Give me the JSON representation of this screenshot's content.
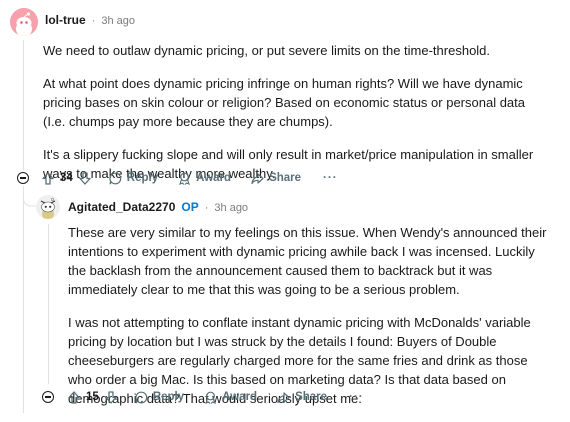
{
  "comments": [
    {
      "username": "lol-true",
      "separator": "·",
      "time": "3h ago",
      "paragraphs": [
        "We need to outlaw dynamic pricing, or put severe limits on the time-threshold.",
        "At what point does dynamic pricing infringe on human rights? Will we have dynamic pricing bases on skin colour or religion? Based on economic status or personal data (I.e. chumps pay more because they are chumps).",
        "It's a slippery fucking slope and will only result in market/price manipulation in smaller ways to make the wealthy more wealthy."
      ],
      "votes": "34",
      "reply_label": "Reply",
      "award_label": "Award",
      "share_label": "Share",
      "more_label": "···"
    },
    {
      "username": "Agitated_Data2270",
      "op_badge": "OP",
      "separator": "·",
      "time": "3h ago",
      "paragraphs": [
        "These are very similar to my feelings on this issue. When Wendy's announced their intentions to experiment with dynamic pricing awhile back I was incensed. Luckily the backlash from the announcement caused them to backtrack but it was immediately clear to me that this was going to be a serious problem.",
        "I was not attempting to conflate instant dynamic pricing with McDonalds' variable pricing by location but I was struck by the details I found: Buyers of Double cheeseburgers are regularly charged more for the same fries and drink as those who order a big Mac. Is this based on marketing data? Is that data based on demographic data? That would seriously upset me."
      ],
      "votes": "15",
      "reply_label": "Reply",
      "award_label": "Award",
      "share_label": "Share",
      "more_label": "···"
    }
  ],
  "colors": {
    "op": "#0079d3",
    "meta": "#7c7c7c",
    "action": "#576f76",
    "avatar1": "#e85d75"
  },
  "icons": [
    "avatar-snoo",
    "collapse-icon",
    "upvote-icon",
    "downvote-icon",
    "reply-icon",
    "award-icon",
    "share-icon",
    "more-icon"
  ]
}
